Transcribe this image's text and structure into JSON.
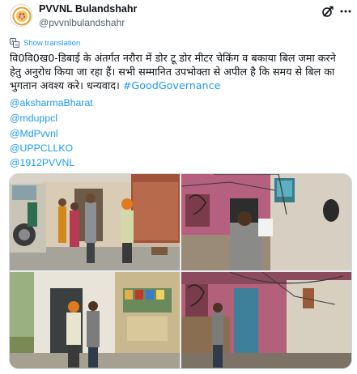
{
  "account": {
    "display_name": "PVVNL Bulandshahr",
    "handle": "@pvvnlbulandshahr",
    "avatar_icon": "pvvnl-logo"
  },
  "header_icons": [
    "grok-icon",
    "more-icon"
  ],
  "translate_label": "Show translation",
  "tweet": {
    "text": "वि0वि0ख0-डिबाई के अंतर्गत नरौरा में डोर टू डोर मीटर चेकिंग व बकाया बिल जमा करने हेतु अनुरोध किया जा रहा हैं। सभी सम्मानित उपभोक्ता से अपील है कि समय से बिल का भुगतान अवश्य करे। धन्यवाद। ",
    "hashtag": "#GoodGovernance",
    "mentions": [
      "@aksharmaBharat",
      "@mduppcl",
      "@MdPvvnl",
      "@UPPCLLKO",
      "@1912PVVNL"
    ]
  },
  "colors": {
    "link": "#1d9bf0",
    "text": "#0f1419",
    "secondary": "#536471"
  },
  "photos": [
    "photo-1",
    "photo-2",
    "photo-3",
    "photo-4"
  ]
}
